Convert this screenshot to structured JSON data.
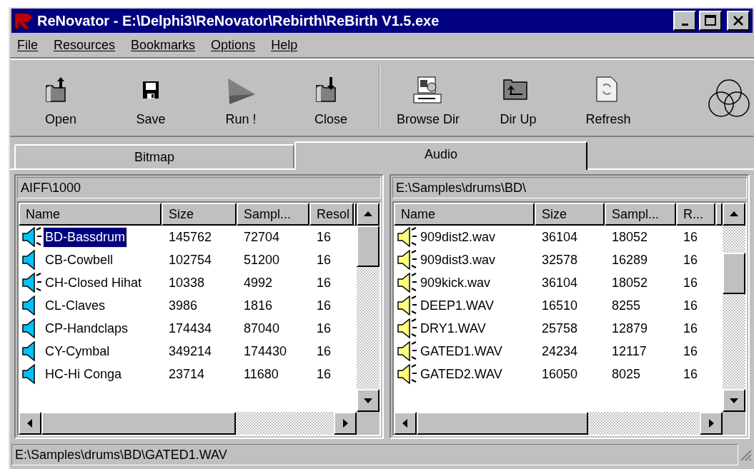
{
  "window": {
    "title": "ReNovator - E:\\Delphi3\\ReNovator\\Rebirth\\ReBirth V1.5.exe"
  },
  "menu": [
    {
      "label": "File"
    },
    {
      "label": "Resources"
    },
    {
      "label": "Bookmarks"
    },
    {
      "label": "Options"
    },
    {
      "label": "Help"
    }
  ],
  "toolbar": [
    {
      "label": "Open",
      "kind": "open"
    },
    {
      "label": "Save",
      "kind": "save"
    },
    {
      "label": "Run !",
      "kind": "run"
    },
    {
      "label": "Close",
      "kind": "close"
    },
    {
      "label": "Browse Dir",
      "kind": "browse"
    },
    {
      "label": "Dir Up",
      "kind": "dirup"
    },
    {
      "label": "Refresh",
      "kind": "refresh"
    }
  ],
  "tabs": [
    {
      "label": "Bitmap",
      "selected": false
    },
    {
      "label": "Audio",
      "selected": true
    }
  ],
  "panes": [
    {
      "path": "AIFF\\1000",
      "columns": [
        "Name",
        "Size",
        "Sampl...",
        "Resol"
      ],
      "rows": [
        {
          "cells": [
            "BD-Bassdrum",
            "145762",
            "72704",
            "16"
          ],
          "sounding": true,
          "selected": true
        },
        {
          "cells": [
            "CB-Cowbell",
            "102754",
            "51200",
            "16"
          ],
          "sounding": false,
          "selected": false
        },
        {
          "cells": [
            "CH-Closed Hihat",
            "10338",
            "4992",
            "16"
          ],
          "sounding": true,
          "selected": false
        },
        {
          "cells": [
            "CL-Claves",
            "3986",
            "1816",
            "16"
          ],
          "sounding": false,
          "selected": false
        },
        {
          "cells": [
            "CP-Handclaps",
            "174434",
            "87040",
            "16"
          ],
          "sounding": false,
          "selected": false
        },
        {
          "cells": [
            "CY-Cymbal",
            "349214",
            "174430",
            "16"
          ],
          "sounding": false,
          "selected": false
        },
        {
          "cells": [
            "HC-Hi Conga",
            "23714",
            "11680",
            "16"
          ],
          "sounding": false,
          "selected": false
        }
      ]
    },
    {
      "path": "E:\\Samples\\drums\\BD\\",
      "columns": [
        "Name",
        "Size",
        "Sampl...",
        "R..."
      ],
      "rows": [
        {
          "cells": [
            "909dist2.wav",
            "36104",
            "18052",
            "16"
          ],
          "sounding": true,
          "selected": false
        },
        {
          "cells": [
            "909dist3.wav",
            "32578",
            "16289",
            "16"
          ],
          "sounding": true,
          "selected": false
        },
        {
          "cells": [
            "909kick.wav",
            "36104",
            "18052",
            "16"
          ],
          "sounding": true,
          "selected": false
        },
        {
          "cells": [
            "DEEP1.WAV",
            "16510",
            "8255",
            "16"
          ],
          "sounding": true,
          "selected": false
        },
        {
          "cells": [
            "DRY1.WAV",
            "25758",
            "12879",
            "16"
          ],
          "sounding": true,
          "selected": false
        },
        {
          "cells": [
            "GATED1.WAV",
            "24234",
            "12117",
            "16"
          ],
          "sounding": true,
          "selected": false
        },
        {
          "cells": [
            "GATED2.WAV",
            "16050",
            "8025",
            "16"
          ],
          "sounding": true,
          "selected": false
        }
      ]
    }
  ],
  "status_bar": "E:\\Samples\\drums\\BD\\GATED1.WAV"
}
